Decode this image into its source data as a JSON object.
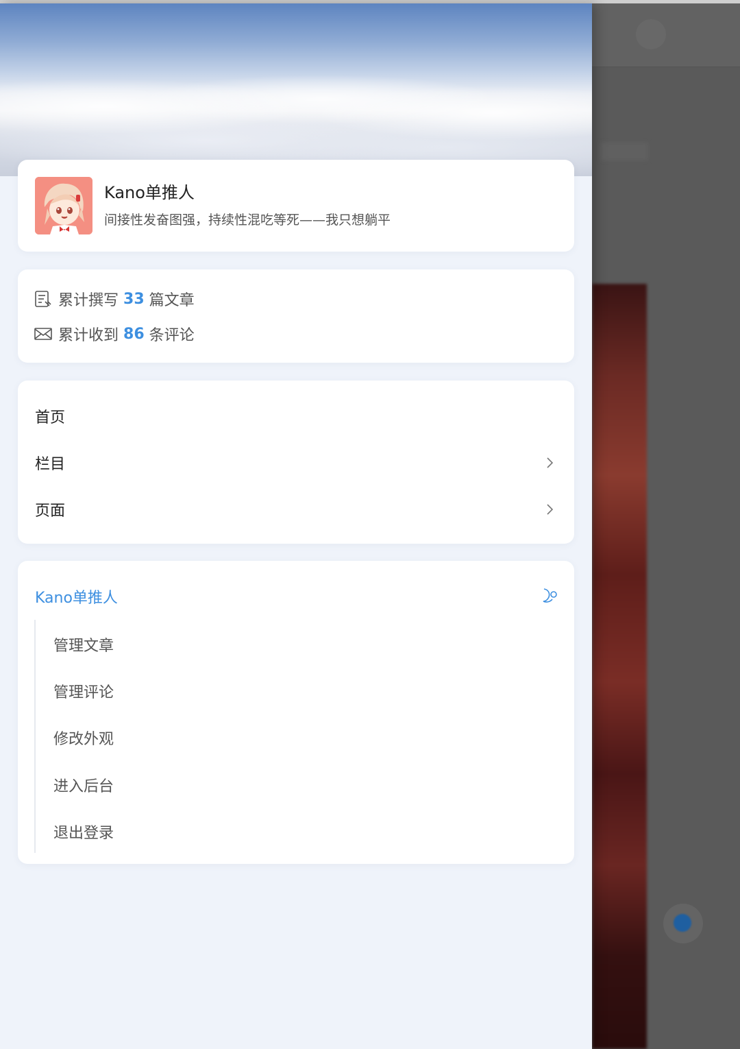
{
  "profile": {
    "name": "Kano单推人",
    "bio": "间接性发奋图强，持续性混吃等死——我只想躺平"
  },
  "stats": {
    "articles_prefix": "累计撰写",
    "articles_count": "33",
    "articles_suffix": "篇文章",
    "comments_prefix": "累计收到",
    "comments_count": "86",
    "comments_suffix": "条评论"
  },
  "nav": {
    "items": [
      {
        "label": "首页",
        "icon": null
      },
      {
        "label": "栏目",
        "icon": "chevron-right-icon"
      },
      {
        "label": "页面",
        "icon": "chevron-right-icon"
      }
    ]
  },
  "user_menu": {
    "title": "Kano单推人",
    "icon": "moon-icon",
    "items": [
      {
        "label": "管理文章"
      },
      {
        "label": "管理评论"
      },
      {
        "label": "修改外观"
      },
      {
        "label": "进入后台"
      },
      {
        "label": "退出登录"
      }
    ]
  },
  "colors": {
    "accent": "#3d8fe0",
    "drawer_bg": "#eff3fa",
    "card_bg": "#ffffff",
    "overlay": "#5a5a5a"
  }
}
